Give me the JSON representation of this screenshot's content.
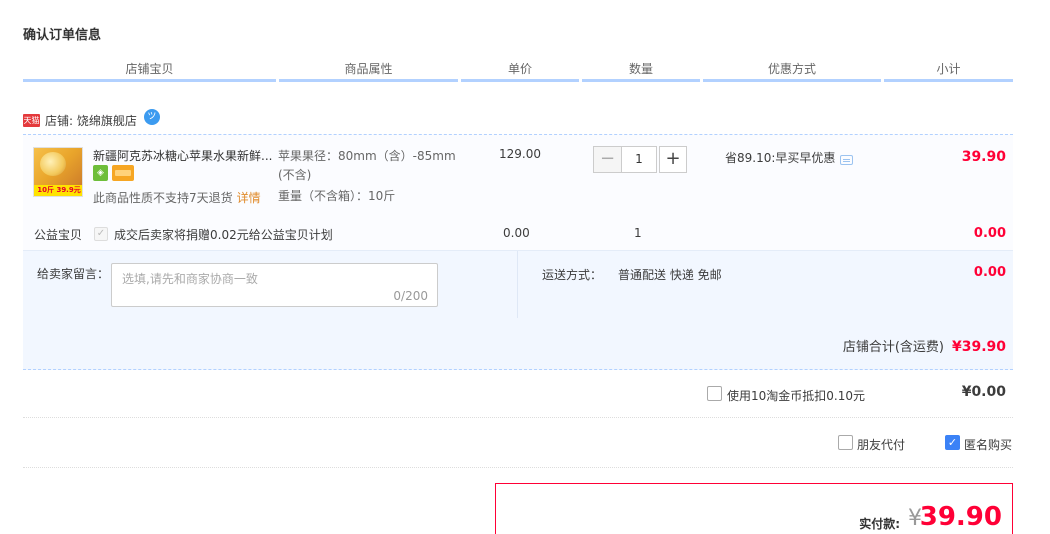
{
  "section_title": "确认订单信息",
  "headers": [
    "店铺宝贝",
    "商品属性",
    "单价",
    "数量",
    "优惠方式",
    "小计"
  ],
  "shop": {
    "badge": "天猫",
    "label": "店铺: 饶绵旗舰店",
    "chat_icon": "wangwang-chat-icon"
  },
  "item": {
    "thumb_tag": "10斤 39.9元",
    "title": "新疆阿克苏冰糖心苹果水果新鲜...",
    "return_note": "此商品性质不支持7天退货",
    "detail_link": "详情",
    "attr_diameter": "苹果果径：80mm（含）-85mm",
    "attr_diameter_cont": "(不含)",
    "attr_weight": "重量（不含箱）：10斤",
    "unit_price": "129.00",
    "quantity": "1",
    "discount": "省89.10:早买早优惠",
    "subtotal": "39.90"
  },
  "charity": {
    "label": "公益宝贝",
    "text": "成交后卖家将捐赠0.02元给公益宝贝计划",
    "price": "0.00",
    "qty": "1",
    "subtotal": "0.00"
  },
  "message": {
    "label": "给卖家留言：",
    "placeholder": "选填,请先和商家协商一致",
    "count": "0/200"
  },
  "shipping": {
    "label": "运送方式：",
    "value": "普通配送 快递 免邮",
    "fee": "0.00"
  },
  "store_total": {
    "label": "店铺合计(含运费)",
    "amount": "¥39.90"
  },
  "coin": {
    "text": "使用10淘金币抵扣0.10元",
    "amount": "¥0.00"
  },
  "options": {
    "friend_pay": "朋友代付",
    "anonymous": "匿名购买"
  },
  "payment": {
    "label": "实付款:",
    "currency": "¥",
    "amount": "39.90"
  },
  "colors": {
    "accent_red": "#ff0036",
    "header_line": "#b2d1ff",
    "panel_bg": "#f2f7ff",
    "checkbox_blue": "#3b82f6"
  }
}
